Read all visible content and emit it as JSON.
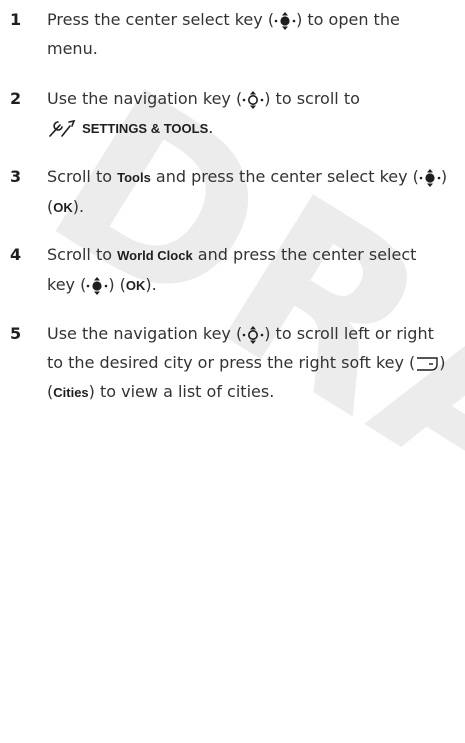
{
  "watermark": "DRAFT",
  "steps": [
    {
      "number": "1",
      "line1_before": "Press the center select key (",
      "icon": "center-select-key-icon",
      "line1_after": ") to open the",
      "line2": "menu."
    },
    {
      "number": "2",
      "line1_before": "Use the navigation key (",
      "icon": "navigation-key-icon",
      "line1_after": ") to scroll to",
      "menu_icon": "settings-tools-icon",
      "menu_label": "SETTINGS & TOOLS",
      "line2_end": "."
    },
    {
      "number": "3",
      "line1_before": "Scroll to ",
      "bold": "Tools",
      "line1_mid": " and press the center select key (",
      "icon": "center-select-key-icon",
      "line1_after": ")",
      "paren_open": "(",
      "softkey": "OK",
      "paren_close": ")."
    },
    {
      "number": "4",
      "line1_before": "Scroll to ",
      "bold": "World Clock",
      "line1_after": " and press the center select",
      "line2_before": "key (",
      "icon": "center-select-key-icon",
      "line2_mid": ") (",
      "softkey": "OK",
      "line2_end": ")."
    },
    {
      "number": "5",
      "line1_before": "Use the navigation key (",
      "icon": "navigation-key-icon",
      "line1_after": ") to scroll left or right",
      "line2_before": "to the desired city or press the right soft key (",
      "softkey_icon": "right-soft-key-icon",
      "line2_after": ")",
      "paren_open": "(",
      "bold": "Cities",
      "line3_after": ") to view a list of cities."
    }
  ]
}
